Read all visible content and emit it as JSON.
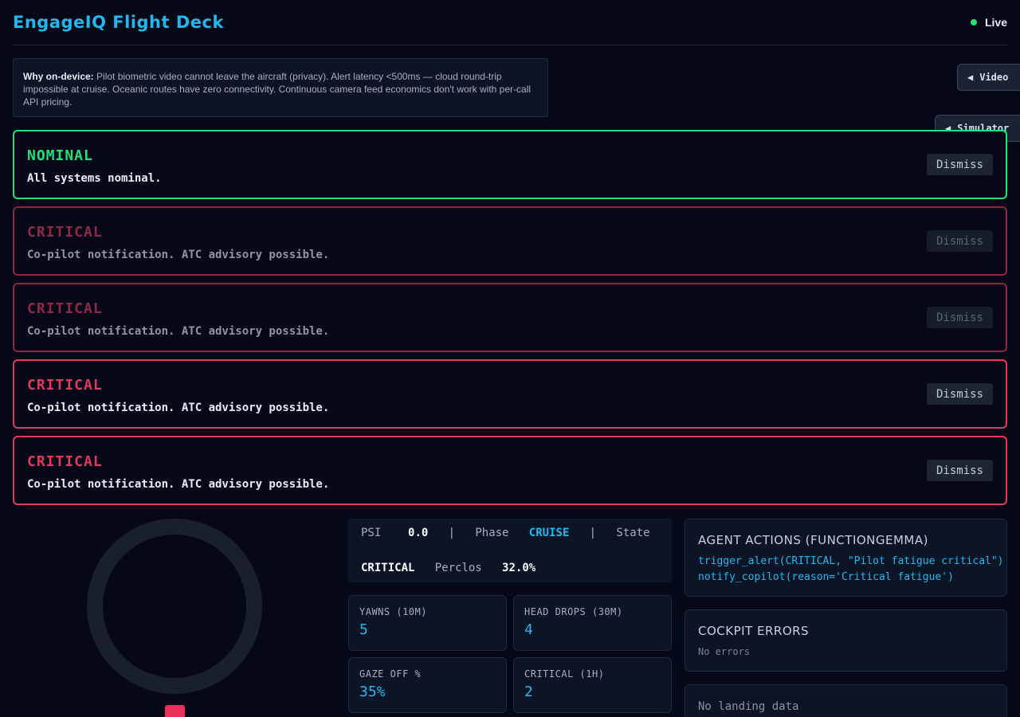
{
  "app": {
    "title": "EngageIQ Flight Deck",
    "live_label": "Live"
  },
  "info": {
    "lead": "Why on-device:",
    "text": " Pilot biometric video cannot leave the aircraft (privacy). Alert latency <500ms — cloud round-trip impossible at cruise. Oceanic routes have zero connectivity. Continuous camera feed economics don't work with per-call API pricing."
  },
  "side_tabs": {
    "video": "Video",
    "simulator": "Simulator"
  },
  "alerts": [
    {
      "level": "NOMINAL",
      "message": "All systems nominal.",
      "dismiss": "Dismiss"
    },
    {
      "level": "CRITICAL",
      "message": "Co-pilot notification. ATC advisory possible.",
      "dismiss": "Dismiss"
    },
    {
      "level": "CRITICAL",
      "message": "Co-pilot notification. ATC advisory possible.",
      "dismiss": "Dismiss"
    },
    {
      "level": "CRITICAL",
      "message": "Co-pilot notification. ATC advisory possible.",
      "dismiss": "Dismiss"
    },
    {
      "level": "CRITICAL",
      "message": "Co-pilot notification. ATC advisory possible.",
      "dismiss": "Dismiss"
    }
  ],
  "status": {
    "psi_label": "PSI",
    "psi_value": "0.0",
    "sep": "|",
    "phase_label": "Phase",
    "phase_value": "CRUISE",
    "state_label": "State",
    "state_value": "CRITICAL",
    "perclos_label": "Perclos",
    "perclos_value": "32.0%"
  },
  "metrics": [
    {
      "label": "YAWNS (10M)",
      "value": "5"
    },
    {
      "label": "HEAD DROPS (30M)",
      "value": "4"
    },
    {
      "label": "GAZE OFF %",
      "value": "35%"
    },
    {
      "label": "CRITICAL (1H)",
      "value": "2"
    }
  ],
  "agent_actions": {
    "title": "AGENT ACTIONS (FUNCTIONGEMMA)",
    "lines": [
      "trigger_alert(CRITICAL, \"Pilot fatigue critical\")",
      "notify_copilot(reason='Critical fatigue')"
    ]
  },
  "cockpit_errors": {
    "title": "COCKPIT ERRORS",
    "text": "No errors"
  },
  "landing": {
    "text": "No landing data"
  },
  "colors": {
    "accent": "#22b8ef",
    "nominal": "#22e07a",
    "critical": "#e03a5e"
  }
}
